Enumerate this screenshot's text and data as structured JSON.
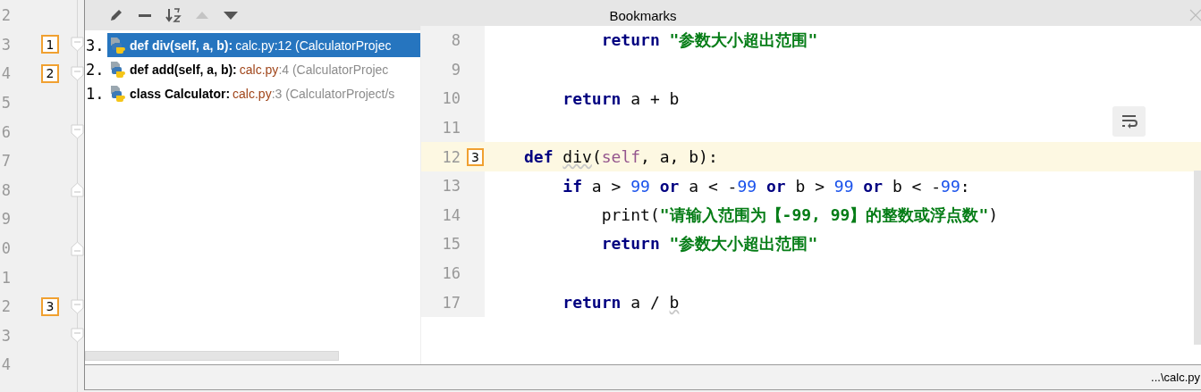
{
  "editor_gutter": {
    "rows": [
      {
        "kind": "plain",
        "number": "2"
      },
      {
        "kind": "fold_start",
        "number": "3",
        "bookmark": "1"
      },
      {
        "kind": "fold_start",
        "number": "4",
        "bookmark": "2"
      },
      {
        "kind": "plain",
        "number": "5"
      },
      {
        "kind": "fold_start",
        "number": "6"
      },
      {
        "kind": "plain",
        "number": "7"
      },
      {
        "kind": "fold_end",
        "number": "8"
      },
      {
        "kind": "plain",
        "number": "9"
      },
      {
        "kind": "fold_end",
        "number": "0"
      },
      {
        "kind": "plain",
        "number": "1"
      },
      {
        "kind": "fold_start",
        "number": "2",
        "bookmark": "3"
      },
      {
        "kind": "fold_start",
        "number": "3"
      },
      {
        "kind": "plain",
        "number": "4"
      }
    ]
  },
  "bookmarks_popup": {
    "toolbar": [
      {
        "kind": "edit",
        "disabled": false
      },
      {
        "kind": "remove",
        "disabled": false
      },
      {
        "kind": "sort",
        "disabled": false
      },
      {
        "kind": "up",
        "disabled": true
      },
      {
        "kind": "down",
        "disabled": false
      }
    ],
    "title": "Bookmarks",
    "items": [
      {
        "index": "3.",
        "name": "def div(self, a, b):",
        "file": "calc.py",
        "line": ":12",
        "location": "(CalculatorProjec",
        "selected": true
      },
      {
        "index": "2.",
        "name": "def add(self, a, b):",
        "file": "calc.py",
        "line": ":4",
        "location": "(CalculatorProjec",
        "selected": false
      },
      {
        "index": "1.",
        "name": "class Calculator:",
        "file": "calc.py",
        "line": ":3",
        "location": "(CalculatorProject/s",
        "selected": false
      }
    ],
    "preview": {
      "lines": [
        {
          "number": "8",
          "current": false,
          "tokens": [
            {
              "kind": "keyword",
              "text": "        return"
            },
            {
              "kind": "string",
              "text": " \"参数大小超出范围\""
            }
          ]
        },
        {
          "number": "9",
          "current": false
        },
        {
          "number": "10",
          "current": false,
          "tokens": [
            {
              "kind": "keyword",
              "text": "    return"
            },
            {
              "kind": "plain",
              "text": " a + b"
            }
          ]
        },
        {
          "number": "11",
          "current": false
        },
        {
          "number": "12",
          "bookmark": "3",
          "current": true,
          "tokens": [
            {
              "kind": "keyword",
              "text": "def "
            },
            {
              "kind": "warn",
              "text": "div"
            },
            {
              "kind": "plain",
              "text": "("
            },
            {
              "kind": "self",
              "text": "self"
            },
            {
              "kind": "plain",
              "text": ", a, b):"
            }
          ]
        },
        {
          "number": "13",
          "current": false,
          "tokens": [
            {
              "kind": "keyword",
              "text": "    if"
            },
            {
              "kind": "plain",
              "text": " a > "
            },
            {
              "kind": "number",
              "text": "99"
            },
            {
              "kind": "keyword",
              "text": " or"
            },
            {
              "kind": "plain",
              "text": " a < -"
            },
            {
              "kind": "number",
              "text": "99"
            },
            {
              "kind": "keyword",
              "text": " or"
            },
            {
              "kind": "plain",
              "text": " b > "
            },
            {
              "kind": "number",
              "text": "99"
            },
            {
              "kind": "keyword",
              "text": " or"
            },
            {
              "kind": "plain",
              "text": " b < -"
            },
            {
              "kind": "number",
              "text": "99"
            },
            {
              "kind": "plain",
              "text": ":"
            }
          ]
        },
        {
          "number": "14",
          "current": false,
          "tokens": [
            {
              "kind": "plain",
              "text": "        print("
            },
            {
              "kind": "string",
              "text": "\"请输入范围为【-99, 99】的整数或浮点数\""
            },
            {
              "kind": "plain",
              "text": ")"
            }
          ]
        },
        {
          "number": "15",
          "current": false,
          "tokens": [
            {
              "kind": "keyword",
              "text": "        return"
            },
            {
              "kind": "string",
              "text": " \"参数大小超出范围\""
            }
          ]
        },
        {
          "number": "16",
          "current": false
        },
        {
          "number": "17",
          "current": false,
          "tokens": [
            {
              "kind": "keyword",
              "text": "    return"
            },
            {
              "kind": "plain",
              "text": " a / "
            },
            {
              "kind": "warn",
              "text": "b"
            }
          ]
        }
      ]
    },
    "status_bar": {
      "path": "...\\calc.py"
    }
  }
}
